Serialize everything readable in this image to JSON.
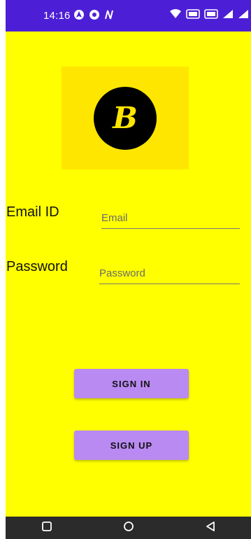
{
  "status_bar": {
    "time": "14:16",
    "icons_left": [
      "maps-icon",
      "chrome-icon",
      "nfc-n-icon"
    ],
    "icons_right": [
      "wifi-icon",
      "sim1-icon",
      "sim2-icon",
      "signal-icon",
      "signal-icon",
      "battery-icon"
    ]
  },
  "logo": {
    "letter": "B"
  },
  "form": {
    "email_label": "Email ID",
    "email_placeholder": "Email",
    "password_label": "Password",
    "password_placeholder": "Password"
  },
  "buttons": {
    "sign_in": "SIGN IN",
    "sign_up": "SIGN UP"
  },
  "nav": {
    "items": [
      "recent-apps",
      "home",
      "back"
    ]
  },
  "colors": {
    "background": "#ffff00",
    "status_bar": "#4c1fd6",
    "button": "#b98af1",
    "nav_bar": "#2b2b2b"
  }
}
